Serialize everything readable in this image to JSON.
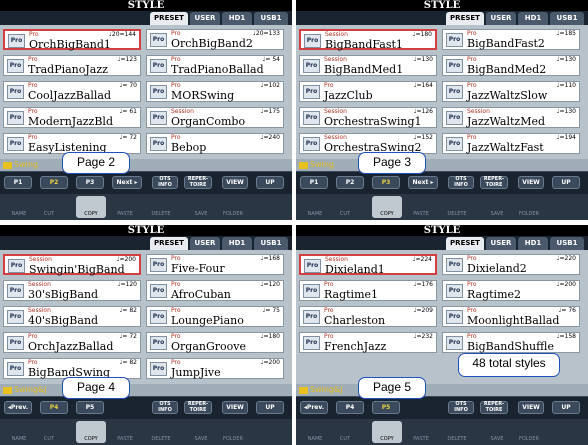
{
  "title": "STYLE",
  "tabs": [
    "PRESET",
    "USER",
    "HD1",
    "USB1"
  ],
  "func_buttons": [
    "NAME",
    "CUT",
    "COPY",
    "PASTE",
    "DELETE",
    "SAVE",
    "FOLDER"
  ],
  "right_buttons": {
    "ots1": "OTS",
    "ots2": "INFO",
    "rep1": "REPER-",
    "rep2": "TOIRE",
    "view": "VIEW",
    "up": "UP"
  },
  "panels": [
    {
      "folder": "Swing",
      "overlay": "Page 2",
      "nav": [
        "P1",
        "P2",
        "P3",
        "Next ▸"
      ],
      "hi": 1,
      "items": [
        {
          "cat": "Pro",
          "tempo": "♩20=144",
          "name": "OrchBigBand1"
        },
        {
          "cat": "Pro",
          "tempo": "♩20=133",
          "name": "OrchBigBand2"
        },
        {
          "cat": "Pro",
          "tempo": "♩=123",
          "name": "TradPianoJazz"
        },
        {
          "cat": "Pro",
          "tempo": "♩= 54",
          "name": "TradPianoBallad"
        },
        {
          "cat": "Pro",
          "tempo": "♩= 70",
          "name": "CoolJazzBallad"
        },
        {
          "cat": "Pro",
          "tempo": "♩=102",
          "name": "MORSwing"
        },
        {
          "cat": "Pro",
          "tempo": "♩= 61",
          "name": "ModernJazzBld"
        },
        {
          "cat": "Session",
          "tempo": "♩=175",
          "name": "OrganCombo"
        },
        {
          "cat": "Pro",
          "tempo": "♩= 72",
          "name": "EasyListening"
        },
        {
          "cat": "Pro",
          "tempo": "♩=240",
          "name": "Bebop"
        }
      ]
    },
    {
      "folder": "Swing",
      "overlay": "Page 3",
      "nav": [
        "P1",
        "P2",
        "P3",
        "Next ▸"
      ],
      "hi": 2,
      "items": [
        {
          "cat": "Session",
          "tempo": "♩=180",
          "name": "BigBandFast1"
        },
        {
          "cat": "Pro",
          "tempo": "♩=185",
          "name": "BigBandFast2"
        },
        {
          "cat": "Session",
          "tempo": "♩=130",
          "name": "BigBandMed1"
        },
        {
          "cat": "Pro",
          "tempo": "♩=130",
          "name": "BigBandMed2"
        },
        {
          "cat": "Pro",
          "tempo": "♩=164",
          "name": "JazzClub"
        },
        {
          "cat": "Pro",
          "tempo": "♩=110",
          "name": "JazzWaltzSlow"
        },
        {
          "cat": "Session",
          "tempo": "♩=126",
          "name": "OrchestraSwing1"
        },
        {
          "cat": "Session",
          "tempo": "♩=130",
          "name": "JazzWaltzMed"
        },
        {
          "cat": "Session",
          "tempo": "♩=152",
          "name": "OrchestraSwing2"
        },
        {
          "cat": "Pro",
          "tempo": "♩=194",
          "name": "JazzWaltzFast"
        }
      ]
    },
    {
      "folder": "Swing&J",
      "overlay": "Page 4",
      "nav": [
        "◂Prev.",
        "P4",
        "P5",
        ""
      ],
      "hi": 1,
      "items": [
        {
          "cat": "Session",
          "tempo": "♩=200",
          "name": "Swingin'BigBand"
        },
        {
          "cat": "Pro",
          "tempo": "♩=168",
          "name": "Five-Four"
        },
        {
          "cat": "Session",
          "tempo": "♩=120",
          "name": "30'sBigBand"
        },
        {
          "cat": "Pro",
          "tempo": "♩=120",
          "name": "AfroCuban"
        },
        {
          "cat": "Session",
          "tempo": "♩= 82",
          "name": "40'sBigBand"
        },
        {
          "cat": "Pro",
          "tempo": "♩= 75",
          "name": "LoungePiano"
        },
        {
          "cat": "Pro",
          "tempo": "♩= 72",
          "name": "OrchJazzBallad"
        },
        {
          "cat": "Pro",
          "tempo": "♩=180",
          "name": "OrganGroove"
        },
        {
          "cat": "Pro",
          "tempo": "♩= 82",
          "name": "BigBandSwing"
        },
        {
          "cat": "Pro",
          "tempo": "♩=200",
          "name": "JumpJive"
        }
      ]
    },
    {
      "folder": "Swing&J",
      "overlay": "Page 5",
      "nav": [
        "◂Prev.",
        "P4",
        "P5",
        ""
      ],
      "hi": 2,
      "items": [
        {
          "cat": "Session",
          "tempo": "♩=224",
          "name": "Dixieland1"
        },
        {
          "cat": "Pro",
          "tempo": "♩=220",
          "name": "Dixieland2"
        },
        {
          "cat": "Pro",
          "tempo": "♩=176",
          "name": "Ragtime1"
        },
        {
          "cat": "Pro",
          "tempo": "♩=200",
          "name": "Ragtime2"
        },
        {
          "cat": "Pro",
          "tempo": "♩=209",
          "name": "Charleston"
        },
        {
          "cat": "Pro",
          "tempo": "♩= 76",
          "name": "MoonlightBallad"
        },
        {
          "cat": "Pro",
          "tempo": "♩=232",
          "name": "FrenchJazz"
        },
        {
          "cat": "Pro",
          "tempo": "♩=158",
          "name": "BigBandShuffle"
        }
      ]
    }
  ],
  "total_label": "48 total styles"
}
